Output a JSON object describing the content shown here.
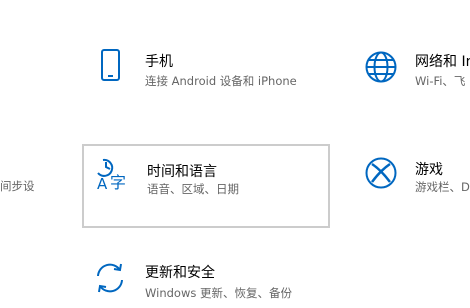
{
  "accent": "#0067c0",
  "tiles": [
    {
      "title": "",
      "subtitle": "间步设",
      "icon": ""
    },
    {
      "title": "手机",
      "subtitle": "连接 Android 设备和 iPhone",
      "icon": "phone-icon"
    },
    {
      "title": "网络和 In",
      "subtitle": "Wi-Fi、飞",
      "icon": "globe-icon"
    },
    {
      "title": "时间和语言",
      "subtitle": "语音、区域、日期",
      "icon": "time-language-icon"
    },
    {
      "title": "游戏",
      "subtitle": "游戏栏、D",
      "icon": "xbox-icon"
    },
    {
      "title": "更新和安全",
      "subtitle": "Windows 更新、恢复、备份",
      "icon": "update-icon"
    }
  ]
}
